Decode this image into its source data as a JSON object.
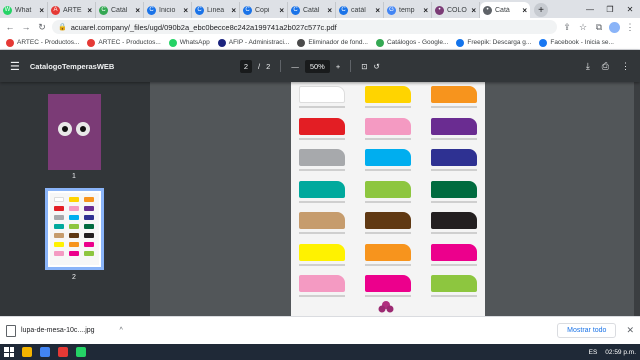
{
  "tabs": [
    {
      "label": "What",
      "color": "#25d366",
      "glyph": "W"
    },
    {
      "label": "ARTE",
      "color": "#e53935",
      "glyph": "A"
    },
    {
      "label": "Catál",
      "color": "#34a853",
      "glyph": "C"
    },
    {
      "label": "Inicio",
      "color": "#1a73e8",
      "glyph": "C"
    },
    {
      "label": "Linea",
      "color": "#1a73e8",
      "glyph": "C"
    },
    {
      "label": "Copi",
      "color": "#1a73e8",
      "glyph": "C"
    },
    {
      "label": "Catál",
      "color": "#1a73e8",
      "glyph": "C"
    },
    {
      "label": "catál",
      "color": "#1a73e8",
      "glyph": "C"
    },
    {
      "label": "temp",
      "color": "#4285f4",
      "glyph": "G"
    },
    {
      "label": "COLO",
      "color": "#7b3b76",
      "glyph": "•"
    },
    {
      "label": "Catá",
      "color": "#5f6368",
      "glyph": "•"
    }
  ],
  "address": {
    "url": "acuarel.company/_files/ugd/090b2a_ebc0becce8c242a199741a2b027c577c.pdf"
  },
  "bookmarks": [
    {
      "label": "ARTEC - Productos...",
      "color": "#e53935"
    },
    {
      "label": "ARTEC - Productos...",
      "color": "#e53935"
    },
    {
      "label": "WhatsApp",
      "color": "#25d366"
    },
    {
      "label": "AFIP - Administraci...",
      "color": "#1a237e"
    },
    {
      "label": "Eliminador de fond...",
      "color": "#4a4a4a"
    },
    {
      "label": "Catálogos - Google...",
      "color": "#34a853"
    },
    {
      "label": "Freepik: Descarga g...",
      "color": "#1273eb"
    },
    {
      "label": "Facebook - Inicia se...",
      "color": "#1877f2"
    }
  ],
  "pdf": {
    "title": "CatalogoTemperasWEB",
    "page_current": "2",
    "page_sep": "/",
    "page_total": "2",
    "zoom": "50%",
    "thumb_labels": [
      "1",
      "2"
    ]
  },
  "swatches": [
    [
      "#ffffff",
      "#ffd400",
      "#f7941d"
    ],
    [
      "#e31e24",
      "#f49ac2",
      "#6a2c91"
    ],
    [
      "#a7a9ac",
      "#00aeef",
      "#2e3192"
    ],
    [
      "#00a99d",
      "#8dc63f",
      "#006b3f"
    ],
    [
      "#c69c6d",
      "#603913",
      "#231f20"
    ],
    [
      "#fff200",
      "#f7941d",
      "#ec008c"
    ],
    [
      "#f49ac2",
      "#ec008c",
      "#8dc63f"
    ]
  ],
  "download": {
    "filename": "lupa-de-mesa-10c....jpg",
    "show_all": "Mostrar todo"
  },
  "taskbar": {
    "lang": "ES",
    "time": "02:59 p.m."
  }
}
